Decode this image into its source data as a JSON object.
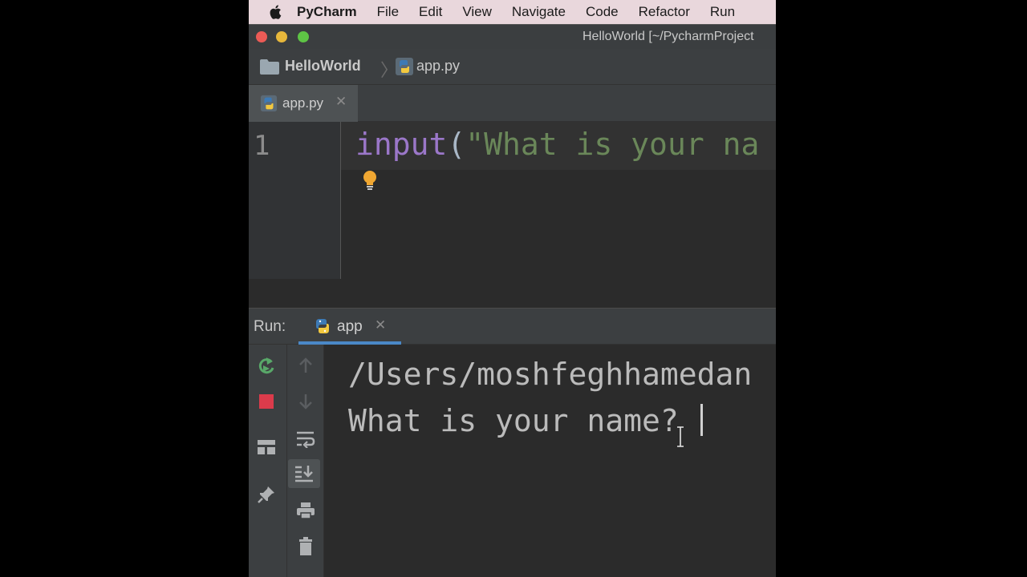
{
  "menubar": {
    "app_name": "PyCharm",
    "items": [
      "File",
      "Edit",
      "View",
      "Navigate",
      "Code",
      "Refactor",
      "Run"
    ]
  },
  "window": {
    "title": "HelloWorld [~/PycharmProject"
  },
  "breadcrumb": {
    "project": "HelloWorld",
    "file": "app.py"
  },
  "editor": {
    "tab_label": "app.py",
    "line_number": "1",
    "code": {
      "function": "input",
      "paren": "(",
      "string": "\"What is your na"
    }
  },
  "run_panel": {
    "label": "Run:",
    "tab_label": "app",
    "console_lines": [
      "/Users/moshfeghhamedan",
      "What is your name? "
    ]
  },
  "colors": {
    "menubar_bg": "#e9d7dc",
    "ide_bg": "#2b2b2b",
    "keyword_purple": "#9b77c9",
    "string_green": "#6a8759",
    "tab_underline_blue": "#4a88c7"
  }
}
